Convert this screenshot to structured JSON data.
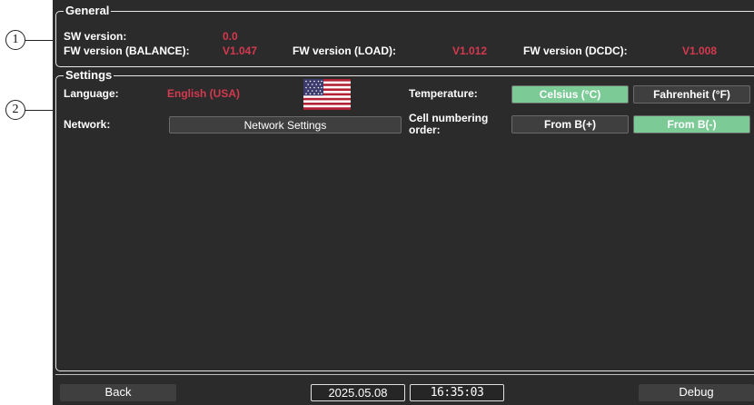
{
  "callouts": [
    "1",
    "2"
  ],
  "general": {
    "legend": "General",
    "sw_version_label": "SW version:",
    "sw_version_value": "0.0",
    "fw_balance_label": "FW version (BALANCE):",
    "fw_balance_value": "V1.047",
    "fw_load_label": "FW version (LOAD):",
    "fw_load_value": "V1.012",
    "fw_dcdc_label": "FW version (DCDC):",
    "fw_dcdc_value": "V1.008"
  },
  "settings": {
    "legend": "Settings",
    "language_label": "Language:",
    "language_value": "English (USA)",
    "language_flag": "us-flag-icon",
    "network_label": "Network:",
    "network_button": "Network Settings",
    "temperature_label": "Temperature:",
    "temperature_options": [
      "Celsius (°C)",
      "Fahrenheit (°F)"
    ],
    "temperature_selected": "Celsius (°C)",
    "cell_numbering_label": "Cell numbering order:",
    "cell_numbering_options": [
      "From B(+)",
      "From B(-)"
    ],
    "cell_numbering_selected": "From B(-)"
  },
  "footer": {
    "back_label": "Back",
    "date": "2025.05.08",
    "time": "16:35:03",
    "debug_label": "Debug"
  },
  "colors": {
    "panel_bg": "#2b2b2b",
    "value_red": "#d4394f",
    "active_green": "#7ccb97",
    "button_bg": "#3f3f3f"
  }
}
